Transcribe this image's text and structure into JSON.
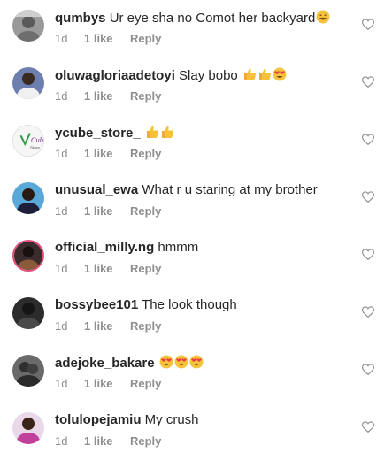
{
  "comments": [
    {
      "username": "qumbys",
      "text": "Ur eye sha no Comot her backyard",
      "emojis": [
        "grin-sweat"
      ],
      "time": "1d",
      "likes": "1 like",
      "reply": "Reply",
      "avatar_color": "#9a9a9a"
    },
    {
      "username": "oluwagloriaadetoyi",
      "text": "Slay bobo",
      "emojis": [
        "thumbs-up",
        "thumbs-up",
        "heart-eyes"
      ],
      "time": "1d",
      "likes": "1 like",
      "reply": "Reply",
      "avatar_color": "#5b6e9a"
    },
    {
      "username": "ycube_store_",
      "text": "",
      "emojis": [
        "thumbs-up",
        "thumbs-up"
      ],
      "time": "1d",
      "likes": "1 like",
      "reply": "Reply",
      "avatar_color": "#f4f4f4"
    },
    {
      "username": "unusual_ewa",
      "text": "What r u staring at my brother",
      "emojis": [],
      "time": "1d",
      "likes": "1 like",
      "reply": "Reply",
      "avatar_color": "#4a9fd0"
    },
    {
      "username": "official_milly.ng",
      "text": "hmmm",
      "emojis": [],
      "time": "1d",
      "likes": "1 like",
      "reply": "Reply",
      "avatar_color": "#3a2c2c"
    },
    {
      "username": "bossybee101",
      "text": "The look though",
      "emojis": [],
      "time": "1d",
      "likes": "1 like",
      "reply": "Reply",
      "avatar_color": "#2c2c2c"
    },
    {
      "username": "adejoke_bakare",
      "text": "",
      "emojis": [
        "heart-eyes",
        "heart-eyes",
        "heart-eyes"
      ],
      "time": "1d",
      "likes": "1 like",
      "reply": "Reply",
      "avatar_color": "#555555"
    },
    {
      "username": "tolulopejamiu",
      "text": "My crush",
      "emojis": [],
      "time": "1d",
      "likes": "1 like",
      "reply": "Reply",
      "avatar_color": "#c0409a"
    }
  ]
}
